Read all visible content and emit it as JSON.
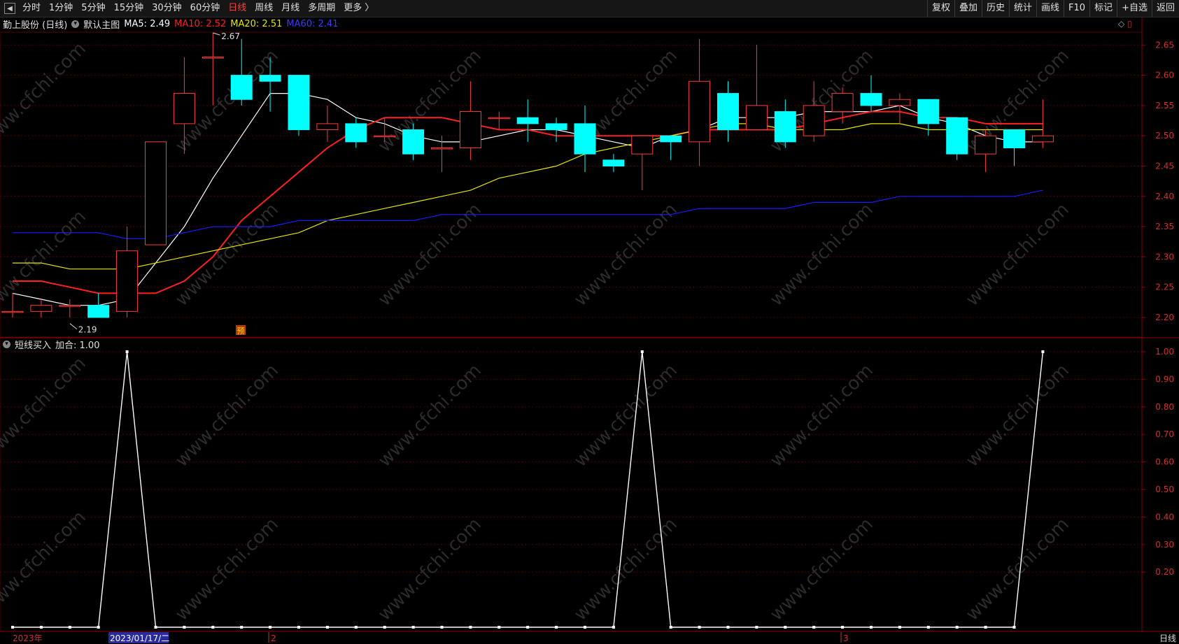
{
  "toolbar": {
    "left": [
      {
        "label": "分时"
      },
      {
        "label": "1分钟"
      },
      {
        "label": "5分钟"
      },
      {
        "label": "15分钟"
      },
      {
        "label": "30分钟"
      },
      {
        "label": "60分钟"
      },
      {
        "label": "日线",
        "active": true
      },
      {
        "label": "周线"
      },
      {
        "label": "月线"
      },
      {
        "label": "多周期"
      },
      {
        "label": "更多 〉"
      }
    ],
    "right": [
      {
        "label": "复权"
      },
      {
        "label": "叠加"
      },
      {
        "label": "历史"
      },
      {
        "label": "统计"
      },
      {
        "label": "画线"
      },
      {
        "label": "F10"
      },
      {
        "label": "标记"
      },
      {
        "label": "+自选"
      },
      {
        "label": "返回"
      }
    ]
  },
  "main_legend": {
    "stock": "勤上股份 (日线)",
    "template": "默认主图",
    "ma5": "MA5: 2.49",
    "ma10": "MA10: 2.52",
    "ma20": "MA20: 2.51",
    "ma60": "MA60: 2.41"
  },
  "sub_legend": {
    "name": "短线买入",
    "value": "加合: 1.00"
  },
  "annotations": {
    "high": "2.67",
    "low": "2.19",
    "pre_tag": "预"
  },
  "x_axis": {
    "year": "2023年",
    "cursor_date": "2023/01/17/二",
    "month2": "2",
    "month3": "3"
  },
  "period_tag": "日线",
  "watermark": "www.cfchi.com",
  "colors": {
    "up": "#ff3b3b",
    "down": "#00ffff",
    "ma5": "#ffffff",
    "ma10": "#ff2020",
    "ma20": "#e6e600",
    "ma60": "#1a1aff",
    "grid": "#5a0000",
    "axis_text": "#d03030"
  },
  "chart_data": [
    {
      "type": "candlestick",
      "title": "勤上股份 (日线)",
      "ylim": [
        2.17,
        2.68
      ],
      "y_ticks": [
        2.2,
        2.25,
        2.3,
        2.35,
        2.4,
        2.45,
        2.5,
        2.55,
        2.6,
        2.65
      ],
      "candles": [
        {
          "o": 2.21,
          "h": 2.24,
          "l": 2.2,
          "c": 2.21
        },
        {
          "o": 2.21,
          "h": 2.23,
          "l": 2.2,
          "c": 2.22
        },
        {
          "o": 2.22,
          "h": 2.23,
          "l": 2.2,
          "c": 2.22
        },
        {
          "o": 2.22,
          "h": 2.24,
          "l": 2.2,
          "c": 2.2
        },
        {
          "o": 2.21,
          "h": 2.35,
          "l": 2.2,
          "c": 2.31
        },
        {
          "o": 2.32,
          "h": 2.49,
          "l": 2.32,
          "c": 2.49
        },
        {
          "o": 2.52,
          "h": 2.63,
          "l": 2.47,
          "c": 2.57
        },
        {
          "o": 2.63,
          "h": 2.67,
          "l": 2.55,
          "c": 2.63
        },
        {
          "o": 2.6,
          "h": 2.66,
          "l": 2.55,
          "c": 2.56
        },
        {
          "o": 2.6,
          "h": 2.63,
          "l": 2.54,
          "c": 2.59
        },
        {
          "o": 2.6,
          "h": 2.6,
          "l": 2.5,
          "c": 2.51
        },
        {
          "o": 2.51,
          "h": 2.55,
          "l": 2.49,
          "c": 2.52
        },
        {
          "o": 2.52,
          "h": 2.53,
          "l": 2.48,
          "c": 2.49
        },
        {
          "o": 2.5,
          "h": 2.53,
          "l": 2.49,
          "c": 2.5
        },
        {
          "o": 2.51,
          "h": 2.52,
          "l": 2.46,
          "c": 2.47
        },
        {
          "o": 2.48,
          "h": 2.5,
          "l": 2.44,
          "c": 2.48
        },
        {
          "o": 2.48,
          "h": 2.59,
          "l": 2.46,
          "c": 2.54
        },
        {
          "o": 2.53,
          "h": 2.54,
          "l": 2.51,
          "c": 2.53
        },
        {
          "o": 2.53,
          "h": 2.56,
          "l": 2.49,
          "c": 2.52
        },
        {
          "o": 2.52,
          "h": 2.53,
          "l": 2.49,
          "c": 2.51
        },
        {
          "o": 2.52,
          "h": 2.55,
          "l": 2.44,
          "c": 2.47
        },
        {
          "o": 2.46,
          "h": 2.47,
          "l": 2.44,
          "c": 2.45
        },
        {
          "o": 2.47,
          "h": 2.5,
          "l": 2.41,
          "c": 2.5
        },
        {
          "o": 2.5,
          "h": 2.5,
          "l": 2.46,
          "c": 2.49
        },
        {
          "o": 2.49,
          "h": 2.66,
          "l": 2.45,
          "c": 2.59
        },
        {
          "o": 2.57,
          "h": 2.59,
          "l": 2.49,
          "c": 2.51
        },
        {
          "o": 2.51,
          "h": 2.65,
          "l": 2.51,
          "c": 2.55
        },
        {
          "o": 2.54,
          "h": 2.56,
          "l": 2.48,
          "c": 2.49
        },
        {
          "o": 2.5,
          "h": 2.59,
          "l": 2.49,
          "c": 2.55
        },
        {
          "o": 2.54,
          "h": 2.58,
          "l": 2.52,
          "c": 2.57
        },
        {
          "o": 2.57,
          "h": 2.6,
          "l": 2.54,
          "c": 2.55
        },
        {
          "o": 2.55,
          "h": 2.57,
          "l": 2.52,
          "c": 2.56
        },
        {
          "o": 2.56,
          "h": 2.56,
          "l": 2.5,
          "c": 2.52
        },
        {
          "o": 2.53,
          "h": 2.53,
          "l": 2.46,
          "c": 2.47
        },
        {
          "o": 2.47,
          "h": 2.51,
          "l": 2.44,
          "c": 2.5
        },
        {
          "o": 2.51,
          "h": 2.51,
          "l": 2.45,
          "c": 2.48
        },
        {
          "o": 2.49,
          "h": 2.56,
          "l": 2.48,
          "c": 2.5
        }
      ],
      "series": [
        {
          "name": "MA5",
          "values": [
            2.24,
            2.23,
            2.22,
            2.22,
            2.23,
            2.29,
            2.35,
            2.43,
            2.5,
            2.57,
            2.57,
            2.56,
            2.53,
            2.52,
            2.5,
            2.49,
            2.49,
            2.5,
            2.51,
            2.51,
            2.5,
            2.49,
            2.48,
            2.5,
            2.51,
            2.53,
            2.53,
            2.53,
            2.54,
            2.54,
            2.54,
            2.55,
            2.53,
            2.52,
            2.5,
            2.49,
            2.49
          ]
        },
        {
          "name": "MA10",
          "values": [
            2.26,
            2.26,
            2.25,
            2.24,
            2.24,
            2.24,
            2.26,
            2.3,
            2.36,
            2.4,
            2.44,
            2.48,
            2.51,
            2.53,
            2.53,
            2.53,
            2.52,
            2.51,
            2.51,
            2.5,
            2.5,
            2.5,
            2.5,
            2.5,
            2.51,
            2.51,
            2.51,
            2.51,
            2.52,
            2.53,
            2.54,
            2.54,
            2.53,
            2.53,
            2.52,
            2.52,
            2.52
          ]
        },
        {
          "name": "MA20",
          "values": [
            2.29,
            2.29,
            2.28,
            2.28,
            2.28,
            2.29,
            2.3,
            2.31,
            2.32,
            2.33,
            2.34,
            2.36,
            2.37,
            2.38,
            2.39,
            2.4,
            2.41,
            2.43,
            2.44,
            2.45,
            2.47,
            2.48,
            2.49,
            2.5,
            2.51,
            2.52,
            2.52,
            2.51,
            2.51,
            2.51,
            2.52,
            2.52,
            2.51,
            2.51,
            2.51,
            2.51,
            2.51
          ]
        },
        {
          "name": "MA60",
          "values": [
            2.34,
            2.34,
            2.34,
            2.34,
            2.33,
            2.33,
            2.34,
            2.35,
            2.35,
            2.35,
            2.36,
            2.36,
            2.36,
            2.36,
            2.36,
            2.37,
            2.37,
            2.37,
            2.37,
            2.37,
            2.37,
            2.37,
            2.37,
            2.37,
            2.38,
            2.38,
            2.38,
            2.38,
            2.39,
            2.39,
            2.39,
            2.4,
            2.4,
            2.4,
            2.4,
            2.4,
            2.41
          ]
        }
      ]
    },
    {
      "type": "line",
      "title": "短线买入",
      "ylim": [
        0,
        1.0
      ],
      "y_ticks": [
        0.2,
        0.3,
        0.4,
        0.5,
        0.6,
        0.7,
        0.8,
        0.9,
        1.0
      ],
      "series": [
        {
          "name": "短线买入",
          "values": [
            0,
            0,
            0,
            0,
            1,
            0,
            0,
            0,
            0,
            0,
            0,
            0,
            0,
            0,
            0,
            0,
            0,
            0,
            0,
            0,
            0,
            0,
            1,
            0,
            0,
            0,
            0,
            0,
            0,
            0,
            0,
            0,
            0,
            0,
            0,
            0,
            1
          ]
        }
      ]
    }
  ]
}
